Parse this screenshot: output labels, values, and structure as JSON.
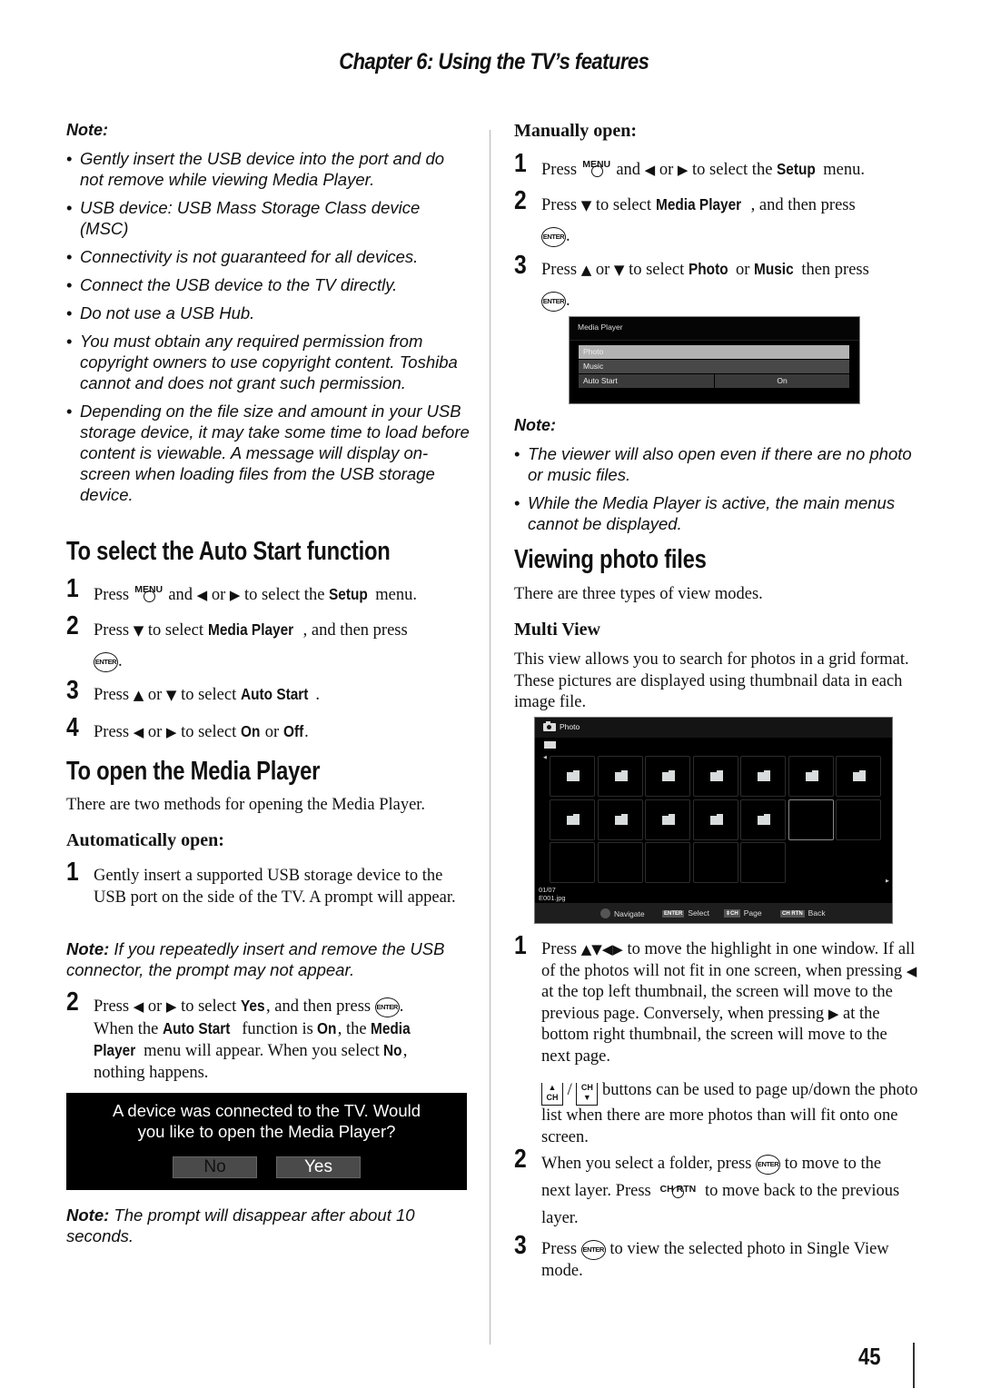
{
  "header": {
    "chapter": "Chapter 6: Using the TV’s features"
  },
  "page_number": "45",
  "left": {
    "note1": {
      "label": "Note:",
      "items": [
        "Gently insert the USB device into the port and do not remove while viewing Media Player.",
        "USB device: USB Mass Storage Class device (MSC)",
        "Connectivity is not guaranteed for all devices.",
        "Connect the USB device to the TV directly.",
        "Do not use a USB Hub.",
        "You must obtain any required permission from copyright owners to use copyright content. Toshiba cannot and does not grant such permission.",
        "Depending on the file size and amount in your USB storage device, it may take some time to load before content is viewable. A message will display on-screen when loading files from the USB storage device."
      ]
    },
    "autostart": {
      "heading": "To select the Auto Start function",
      "steps": [
        {
          "num": "1",
          "t1": "Press",
          "key": "MENU",
          "t2": "and",
          "t3": "or",
          "t4": "to select the",
          "b1": "Setup",
          "t5": "menu."
        },
        {
          "num": "2",
          "t1": "Press",
          "t2": "to select",
          "b1": "Media Player",
          "t3": ", and then press",
          "key": "ENTER",
          "t4": "."
        },
        {
          "num": "3",
          "t1": "Press",
          "t2": "or",
          "t3": "to select",
          "b1": "Auto Start",
          "t4": "."
        },
        {
          "num": "4",
          "t1": "Press",
          "t2": "or",
          "t3": "to select",
          "b1": "On",
          "t4": "or",
          "b2": "Off",
          "t5": "."
        }
      ]
    },
    "open": {
      "heading": "To open the Media Player",
      "intro": "There are two methods for opening the Media Player.",
      "auto_heading": "Automatically open:",
      "step1": {
        "num": "1",
        "text": "Gently insert a supported USB storage device to the USB port on the side of the TV. A prompt will appear."
      },
      "note2": {
        "label": "Note:",
        "text": "If you repeatedly insert and remove the USB connector, the prompt may not appear."
      },
      "step2": {
        "num": "2",
        "t1": "Press",
        "t2": "or",
        "t3": "to select",
        "b1": "Yes",
        "t4": ", and then press",
        "key": "ENTER",
        "t5": ".",
        "t6": "When the",
        "b2": "Auto Start",
        "t7": "function is",
        "b3": "On",
        "t8": ", the",
        "b4": "Media",
        "b5": "Player",
        "t9": "menu will appear. When you select",
        "b6": "No",
        "t10": ",",
        "t11": "nothing happens."
      },
      "prompt": {
        "message_line1": "A device was connected to the TV. Would",
        "message_line2": "you like to open the Media Player?",
        "no_label": "No",
        "yes_label": "Yes"
      },
      "note3": {
        "label": "Note:",
        "text": "The prompt will disappear after about 10",
        "text2": "seconds."
      }
    }
  },
  "right": {
    "manual": {
      "heading": "Manually open:",
      "steps": [
        {
          "num": "1",
          "t1": "Press",
          "key": "MENU",
          "t2": "and",
          "t3": "or",
          "t4": "to select the",
          "b1": "Setup",
          "t5": "menu."
        },
        {
          "num": "2",
          "t1": "Press",
          "t2": "to select",
          "b1": "Media Player",
          "t3": ", and then press",
          "key": "ENTER",
          "t4": "."
        },
        {
          "num": "3",
          "t1": "Press",
          "t2": "or",
          "t3": "to select",
          "b1": "Photo",
          "t4": "or",
          "b2": "Music",
          "t5": "then press",
          "key": "ENTER",
          "t6": "."
        }
      ]
    },
    "media_menu": {
      "title": "Media Player",
      "items": [
        "Photo",
        "Music",
        "Auto Start"
      ],
      "selected": "Photo",
      "auto_start_value": "On"
    },
    "note4": {
      "label": "Note:",
      "items": [
        "The viewer will also open even if there are no photo or music files.",
        "While the Media Player is active, the main menus cannot be displayed."
      ]
    },
    "viewing": {
      "heading": "Viewing photo files",
      "intro": "There are three types of view modes.",
      "multi_heading": "Multi View",
      "multi_text": "This view allows you to search for photos in a grid format. These pictures are displayed using thumbnail data in each image file."
    },
    "photo_screen": {
      "title": "Photo",
      "counter": "01/07",
      "filename": "E001.jpg",
      "grid_cells": [
        "folder",
        "folder",
        "folder",
        "folder",
        "folder",
        "folder",
        "folder",
        "folder",
        "folder",
        "folder",
        "folder",
        "folder",
        "selected",
        "empty",
        "empty",
        "empty",
        "empty",
        "empty",
        "empty"
      ],
      "footer": [
        {
          "key": "",
          "label": "Navigate"
        },
        {
          "key": "ENTER",
          "label": "Select"
        },
        {
          "key": "⇕CH",
          "label": "Page"
        },
        {
          "key": "CH RTN",
          "label": "Back"
        }
      ]
    },
    "steps": [
      {
        "num": "1",
        "t1": "Press",
        "arrows": "▲▼◀▶",
        "t2": "to move the highlight in one window. If all of the photos will not fit in one screen, when pressing",
        "t3": "at the top left thumbnail, the screen will move to the previous page. Conversely, when pressing",
        "t4": "at the bottom right thumbnail, the screen will move to the next page.",
        "t5": "/",
        "t6": "buttons can be used to page up/down the photo list when there are more photos than will fit onto one screen."
      },
      {
        "num": "2",
        "t1": "When you select a folder, press",
        "key": "ENTER",
        "t2": "to move to the",
        "t3": "next layer. Press",
        "key2": "CH RTN",
        "t4": "to move back to the previous layer."
      },
      {
        "num": "3",
        "t1": "Press",
        "key": "ENTER",
        "t2": "to view the selected photo in Single View mode."
      }
    ]
  }
}
